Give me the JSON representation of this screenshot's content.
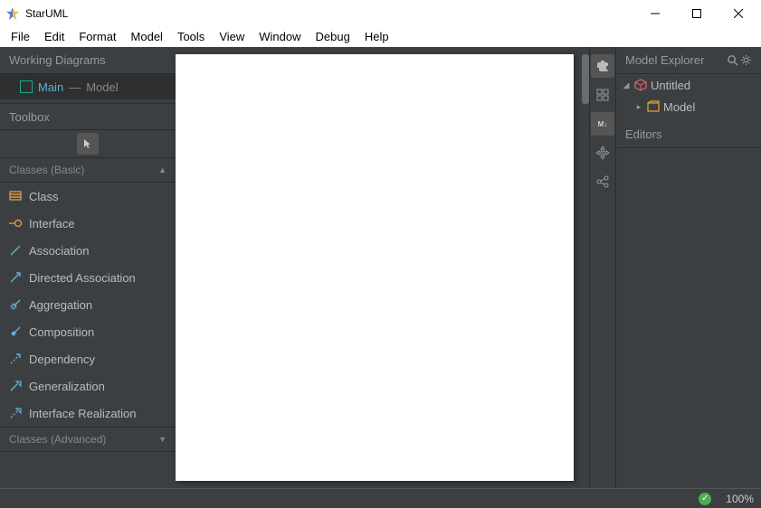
{
  "title": "StarUML",
  "menu": [
    "File",
    "Edit",
    "Format",
    "Model",
    "Tools",
    "View",
    "Window",
    "Debug",
    "Help"
  ],
  "left": {
    "working_diagrams": "Working Diagrams",
    "diagram": {
      "main": "Main",
      "sep": " — ",
      "sub": "Model"
    },
    "toolbox": "Toolbox",
    "section_basic": "Classes (Basic)",
    "tools": [
      "Class",
      "Interface",
      "Association",
      "Directed Association",
      "Aggregation",
      "Composition",
      "Dependency",
      "Generalization",
      "Interface Realization"
    ],
    "section_advanced": "Classes (Advanced)"
  },
  "right": {
    "explorer": "Model Explorer",
    "project": "Untitled",
    "model": "Model",
    "editors": "Editors"
  },
  "status": {
    "zoom": "100%"
  },
  "colors": {
    "accent": "#5fb1d6",
    "orange": "#e8a33d",
    "green": "#4caf50"
  }
}
